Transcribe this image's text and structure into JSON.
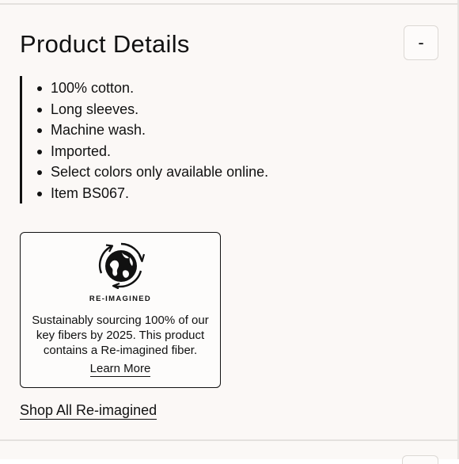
{
  "section": {
    "title": "Product Details",
    "toggle_label": "-"
  },
  "details": {
    "items": [
      "100% cotton.",
      "Long sleeves.",
      "Machine wash.",
      "Imported.",
      "Select colors only available online.",
      "Item BS067."
    ]
  },
  "reimagined_card": {
    "icon": "globe-leaves-recycle-icon",
    "badge_label": "RE-IMAGINED",
    "description": "Sustainably sourcing 100% of our key fibers by 2025. This product contains a Re-imagined fiber.",
    "link_label": "Learn More"
  },
  "shop_all_link": "Shop All Re-imagined",
  "colors": {
    "panel_background": "#fbf8f6",
    "text": "#111111",
    "divider": "#e4e1de"
  }
}
